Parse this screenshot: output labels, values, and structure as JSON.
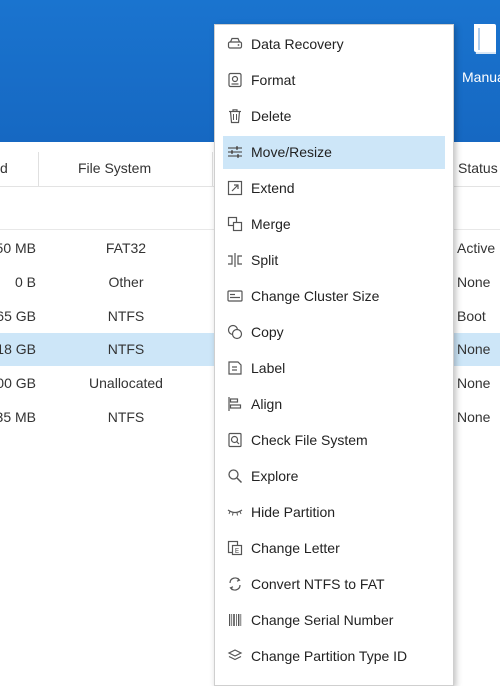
{
  "toolbar": {
    "manual_label": "Manual"
  },
  "table": {
    "headers": {
      "size_partial": "d",
      "file_system": "File System",
      "status": "Status"
    },
    "rows": [
      {
        "size": "50 MB",
        "fs": "FAT32",
        "status": "Active",
        "selected": false
      },
      {
        "size": "0 B",
        "fs": "Other",
        "status": "None",
        "selected": false
      },
      {
        "size": "65 GB",
        "fs": "NTFS",
        "status": "Boot",
        "selected": false
      },
      {
        "size": "18 GB",
        "fs": "NTFS",
        "status": "None",
        "selected": true
      },
      {
        "size": "00 GB",
        "fs": "Unallocated",
        "status": "None",
        "selected": false
      },
      {
        "size": "35 MB",
        "fs": "NTFS",
        "status": "None",
        "selected": false
      }
    ]
  },
  "context_menu": {
    "items": [
      {
        "label": "Data Recovery",
        "icon": "data-recovery-icon"
      },
      {
        "label": "Format",
        "icon": "format-icon"
      },
      {
        "label": "Delete",
        "icon": "trash-icon"
      },
      {
        "label": "Move/Resize",
        "icon": "sliders-icon",
        "highlighted": true
      },
      {
        "label": "Extend",
        "icon": "extend-icon"
      },
      {
        "label": "Merge",
        "icon": "merge-icon"
      },
      {
        "label": "Split",
        "icon": "split-icon"
      },
      {
        "label": "Change Cluster Size",
        "icon": "cluster-icon"
      },
      {
        "label": "Copy",
        "icon": "copy-icon"
      },
      {
        "label": "Label",
        "icon": "label-icon"
      },
      {
        "label": "Align",
        "icon": "align-icon"
      },
      {
        "label": "Check File System",
        "icon": "check-file-icon"
      },
      {
        "label": "Explore",
        "icon": "search-icon"
      },
      {
        "label": "Hide Partition",
        "icon": "hide-eye-icon"
      },
      {
        "label": "Change Letter",
        "icon": "change-letter-icon"
      },
      {
        "label": "Convert NTFS to FAT",
        "icon": "convert-icon"
      },
      {
        "label": "Change Serial Number",
        "icon": "barcode-icon"
      },
      {
        "label": "Change Partition Type ID",
        "icon": "layers-icon"
      }
    ]
  }
}
